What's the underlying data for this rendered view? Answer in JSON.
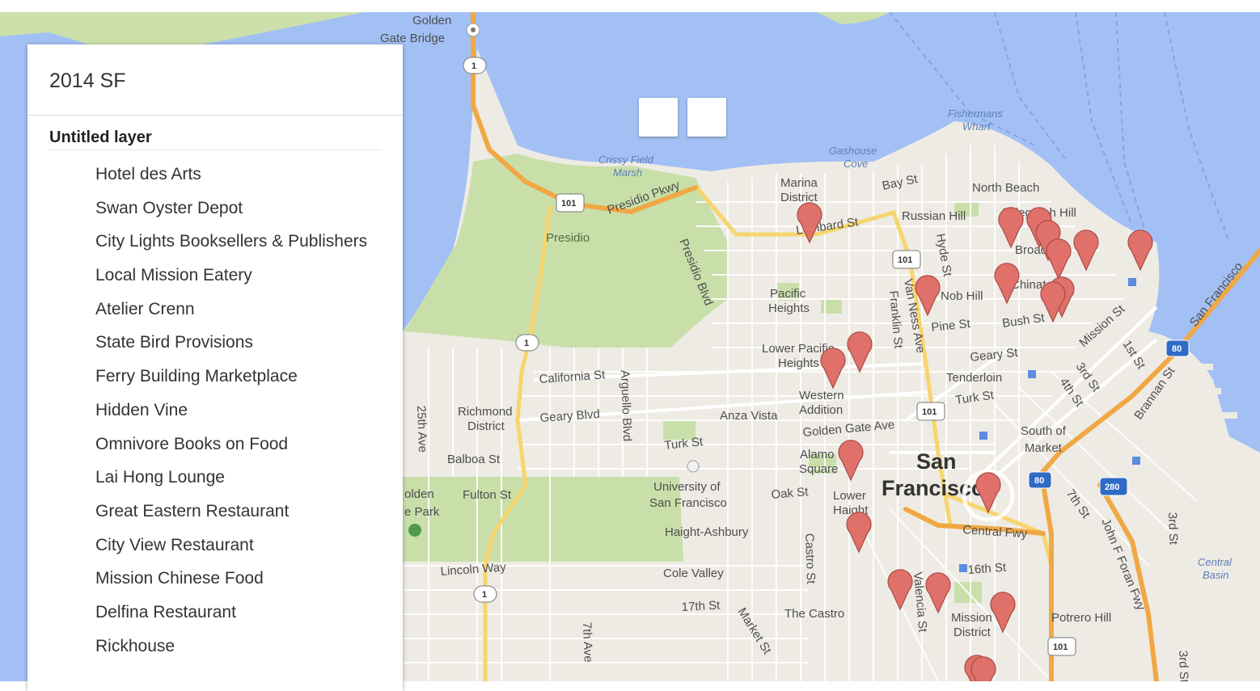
{
  "panel": {
    "title": "2014 SF",
    "layer": "Untitled layer",
    "places": [
      "Hotel des Arts",
      "Swan Oyster Depot",
      "City Lights Booksellers & Publishers",
      "Local Mission Eatery",
      "Atelier Crenn",
      "State Bird Provisions",
      "Ferry Building Marketplace",
      "Hidden Vine",
      "Omnivore Books on Food",
      "Lai Hong Lounge",
      "Great Eastern Restaurant",
      "City View Restaurant",
      "Mission Chinese Food",
      "Delfina Restaurant",
      "Rickhouse"
    ]
  },
  "map": {
    "colors": {
      "water": "#a3c0f4",
      "land": "#eeebe4",
      "park": "#c9dfaa",
      "street": "#ffffff",
      "highway": "#f5a946",
      "marker": "#e0706a"
    },
    "labels": {
      "golden": "Golden",
      "gate_bridge": "Gate Bridge",
      "fishermans": "Fishermans",
      "wharf": "Wharf",
      "crissy": "Crissy Field",
      "marsh": "Marsh",
      "gashouse": "Gashouse",
      "cove": "Cove",
      "marina": "Marina",
      "district": "District",
      "bay_st": "Bay St",
      "north_beach": "North Beach",
      "telegraph_hill": "Telegraph Hill",
      "presidio_pkwy": "Presidio Pkwy",
      "presidio": "Presidio",
      "lombard": "Lombard St",
      "russian_hill": "Russian Hill",
      "hyde_st": "Hyde St",
      "broadway": "Broadway",
      "chinatown": "Chinatown",
      "nob_hill": "Nob Hill",
      "pacific": "Pacific",
      "heights": "Heights",
      "presidio_blvd": "Presidio Blvd",
      "van_ness": "Van Ness Ave",
      "franklin": "Franklin St",
      "pine_st": "Pine St",
      "bush_st": "Bush St",
      "mission_st": "Mission St",
      "first_st": "1st St",
      "san_francisco_road": "San Francisco",
      "lower_pacific": "Lower Pacific",
      "lp_heights": "Heights",
      "geary_st": "Geary St",
      "california_st": "California St",
      "arguello": "Arguello Blvd",
      "tenderloin": "Tenderloin",
      "turk_st": "Turk St",
      "third_st": "3rd St",
      "fourth_st": "4th St",
      "brannan": "Brannan St",
      "western": "Western",
      "addition": "Addition",
      "richmond": "Richmond",
      "rich_district": "District",
      "geary_blvd": "Geary Blvd",
      "anza_vista": "Anza Vista",
      "golden_gate_ave": "Golden Gate Ave",
      "twentyfifth": "25th Ave",
      "south_of": "South of",
      "market": "Market",
      "turk_st2": "Turk St",
      "alamo": "Alamo",
      "square": "Square",
      "san": "San",
      "francisco": "Francisco",
      "balboa": "Balboa St",
      "university_of": "University of",
      "usf": "San Francisco",
      "oak_st": "Oak St",
      "lower": "Lower",
      "haight": "Haight",
      "golden_park": "olden",
      "gate_park": "e Park",
      "fulton": "Fulton St",
      "central_fwy": "Central Fwy",
      "seventh_st": "7th St",
      "john_f_foran": "John F Foran Fwy",
      "haight_ashbury": "Haight-Ashbury",
      "third_st2": "3rd St",
      "central": "Central",
      "basin": "Basin",
      "lincoln": "Lincoln Way",
      "cole_valley": "Cole Valley",
      "castro_st": "Castro St",
      "sixteenth": "16th St",
      "valencia": "Valencia St",
      "seventeenth": "17th St",
      "the_castro": "The Castro",
      "mission": "Mission",
      "mission_district": "District",
      "potrero_hill": "Potrero Hill",
      "seventh_ave": "7th Ave",
      "market_st": "Market St",
      "third_st3": "3rd St"
    },
    "shields": {
      "ca1": "1",
      "us101": "101",
      "i80": "80",
      "i280": "280"
    }
  }
}
